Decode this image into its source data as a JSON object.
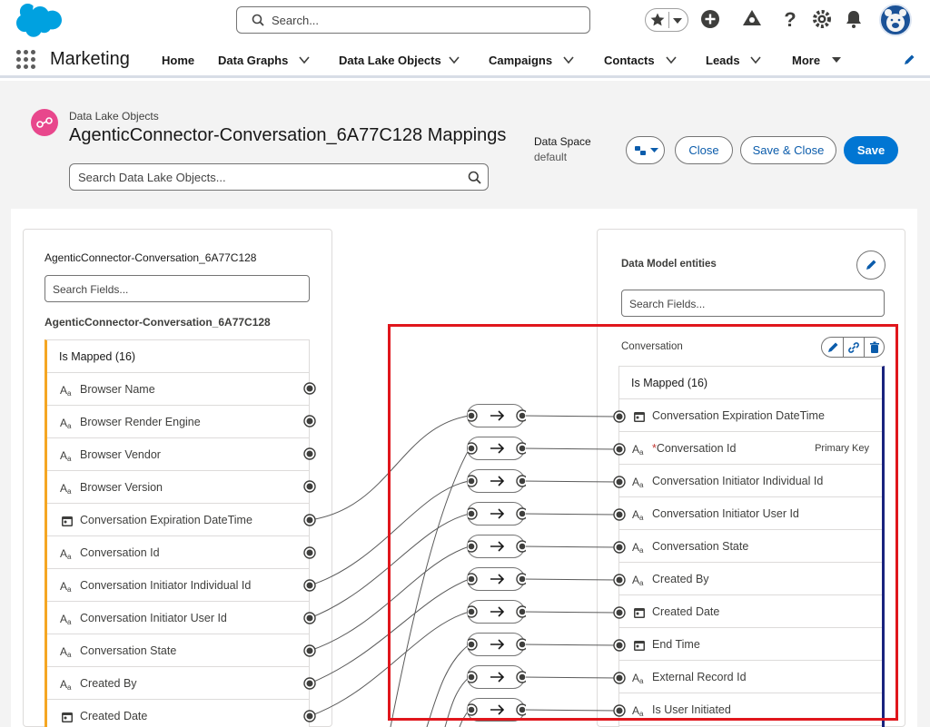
{
  "header": {
    "search_placeholder": "Search..."
  },
  "app_nav": {
    "app_name": "Marketing",
    "items": [
      {
        "label": "Home"
      },
      {
        "label": "Data Graphs"
      },
      {
        "label": "Data Lake Objects"
      },
      {
        "label": "Campaigns"
      },
      {
        "label": "Contacts"
      },
      {
        "label": "Leads"
      },
      {
        "label": "More"
      }
    ]
  },
  "page_header": {
    "breadcrumb": "Data Lake Objects",
    "title": "AgenticConnector-Conversation_6A77C128 Mappings",
    "search_placeholder": "Search Data Lake Objects...",
    "data_space_label": "Data Space",
    "data_space_value": "default",
    "buttons": {
      "close": "Close",
      "save_close": "Save & Close",
      "save": "Save"
    }
  },
  "left_panel": {
    "title": "AgenticConnector-Conversation_6A77C128",
    "search_placeholder": "Search Fields...",
    "subtitle": "AgenticConnector-Conversation_6A77C128",
    "group_label": "Is Mapped (16)",
    "fields": [
      {
        "label": "Browser Name",
        "icon": "text-icon"
      },
      {
        "label": "Browser Render Engine",
        "icon": "text-icon"
      },
      {
        "label": "Browser Vendor",
        "icon": "text-icon"
      },
      {
        "label": "Browser Version",
        "icon": "text-icon"
      },
      {
        "label": "Conversation Expiration DateTime",
        "icon": "calendar-icon"
      },
      {
        "label": "Conversation Id",
        "icon": "text-icon"
      },
      {
        "label": "Conversation Initiator Individual Id",
        "icon": "text-icon"
      },
      {
        "label": "Conversation Initiator User Id",
        "icon": "text-icon"
      },
      {
        "label": "Conversation State",
        "icon": "text-icon"
      },
      {
        "label": "Created By",
        "icon": "text-icon"
      },
      {
        "label": "Created Date",
        "icon": "calendar-icon"
      }
    ]
  },
  "right_panel": {
    "title": "Data Model entities",
    "search_placeholder": "Search Fields...",
    "entity_name": "Conversation",
    "group_label": "Is Mapped (16)",
    "fields": [
      {
        "label": "Conversation Expiration DateTime",
        "icon": "calendar-icon",
        "required": false,
        "key": ""
      },
      {
        "label": "Conversation Id",
        "icon": "text-icon",
        "required": true,
        "key": "Primary Key"
      },
      {
        "label": "Conversation Initiator Individual Id",
        "icon": "text-icon",
        "required": false,
        "key": ""
      },
      {
        "label": "Conversation Initiator User Id",
        "icon": "text-icon",
        "required": false,
        "key": ""
      },
      {
        "label": "Conversation State",
        "icon": "text-icon",
        "required": false,
        "key": ""
      },
      {
        "label": "Created By",
        "icon": "text-icon",
        "required": false,
        "key": ""
      },
      {
        "label": "Created Date",
        "icon": "calendar-icon",
        "required": false,
        "key": ""
      },
      {
        "label": "End Time",
        "icon": "calendar-icon",
        "required": false,
        "key": ""
      },
      {
        "label": "External Record Id",
        "icon": "text-icon",
        "required": false,
        "key": ""
      },
      {
        "label": "Is User Initiated",
        "icon": "text-icon",
        "required": false,
        "key": ""
      }
    ],
    "required_marker": "*"
  },
  "colors": {
    "brand": "#0176d3",
    "highlight": "#e0161c",
    "source_accent": "#f5a623",
    "target_accent": "#1a237e"
  }
}
